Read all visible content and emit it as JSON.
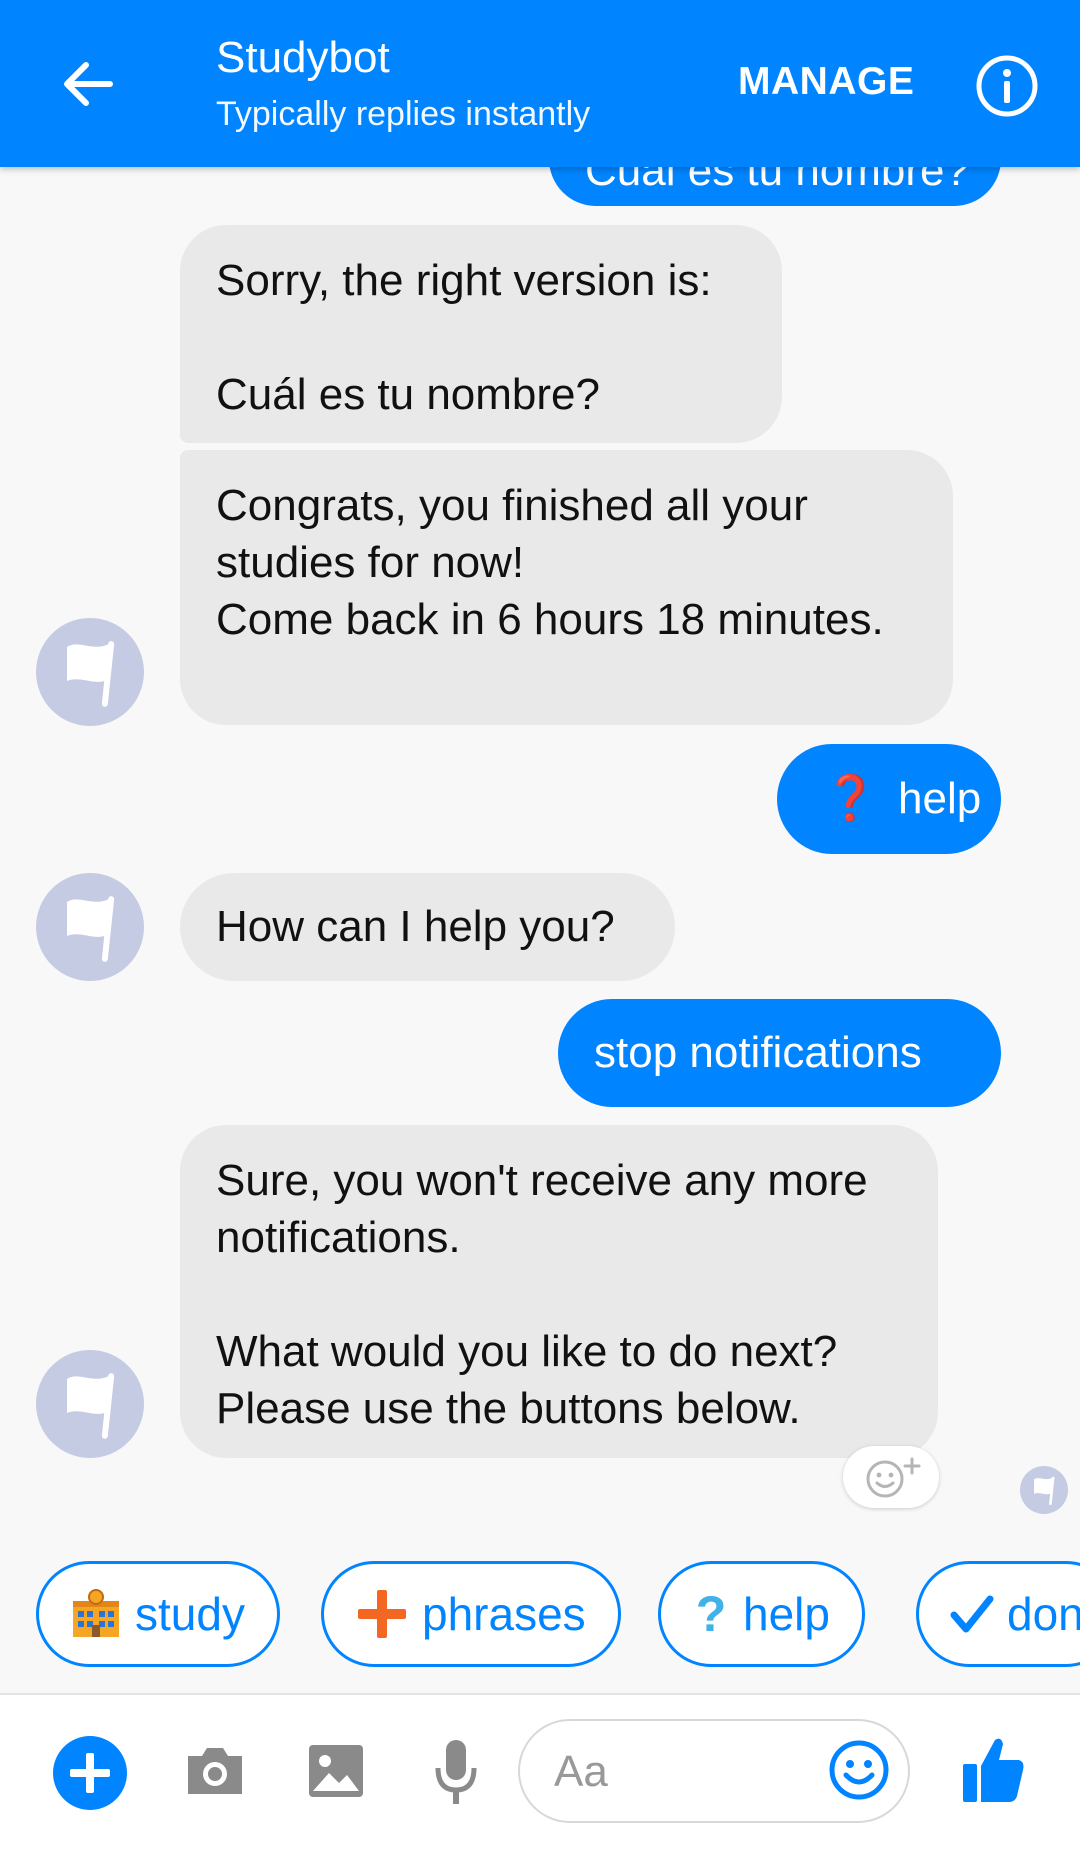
{
  "header": {
    "title": "Studybot",
    "subtitle": "Typically replies instantly",
    "manage_label": "MANAGE",
    "back_icon": "arrow-left-icon",
    "info_icon": "info-icon",
    "color": "#0084ff"
  },
  "messages": [
    {
      "from": "user",
      "text": "Cuál es tu nombre?",
      "partial": true
    },
    {
      "from": "bot",
      "text": "Sorry, the right version is:\n\nCuál es tu nombre?"
    },
    {
      "from": "bot",
      "text": "Congrats, you finished all your studies for now!\nCome back in 6 hours 18 minutes."
    },
    {
      "from": "user",
      "emoji": "❓",
      "text": "help"
    },
    {
      "from": "bot",
      "text": "How can I help you?"
    },
    {
      "from": "user",
      "text": "stop notifications"
    },
    {
      "from": "bot",
      "text": "Sure, you won't receive any more notifications.\n\nWhat would you like to do next? Please use the buttons below."
    }
  ],
  "quick_replies": [
    {
      "icon": "school-icon",
      "emoji": "🏫",
      "label": "study"
    },
    {
      "icon": "plus-icon",
      "emoji": "➕",
      "label": "phrases"
    },
    {
      "icon": "question-icon",
      "emoji": "❔",
      "label": "help"
    },
    {
      "icon": "check-icon",
      "emoji": "✔",
      "label": "don"
    }
  ],
  "composer": {
    "placeholder": "Aa",
    "icons": [
      "plus-circle-icon",
      "camera-icon",
      "image-icon",
      "microphone-icon",
      "emoji-icon",
      "thumbs-up-icon"
    ]
  },
  "colors": {
    "accent": "#0084ff",
    "bot_bubble": "#e9e9e9",
    "avatar": "#c5cbe3",
    "background": "#f8f8f8"
  }
}
